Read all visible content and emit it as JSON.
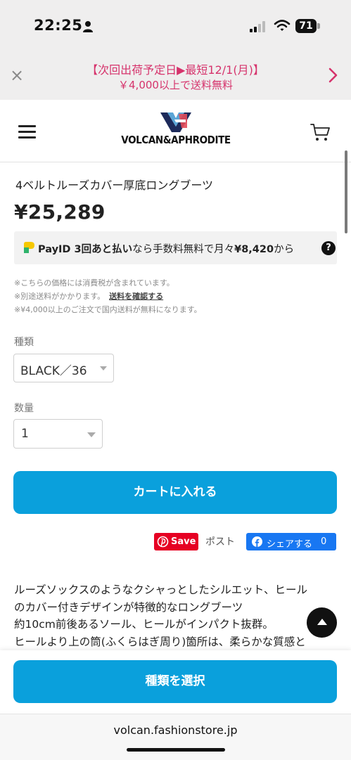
{
  "status_bar": {
    "time": "22:25",
    "battery": "71",
    "icons": [
      "person-icon",
      "signal-icon",
      "wifi-icon",
      "battery-icon"
    ]
  },
  "announcement": {
    "line1": "【次回出荷予定日▶最短12/1(月)】",
    "line2": "￥4,000以上で送料無料",
    "color": "#d6336c"
  },
  "header": {
    "logo_text": "VOLCAN&APHRODITE",
    "icons": [
      "hamburger-menu-icon",
      "cart-icon"
    ]
  },
  "product": {
    "title": "4ベルトルーズカバー厚底ロングブーツ",
    "price": "¥25,289"
  },
  "payid": {
    "brand": "PayID 3回あと払い",
    "middle": "なら手数料無料で月々",
    "amount": "¥8,420",
    "suffix": "から",
    "help": "?"
  },
  "notes": {
    "line1": "※こちらの価格には消費税が含まれています。",
    "line2_prefix": "※別途送料がかかります。",
    "line2_link": "送料を確認する",
    "line3": "※¥4,000以上のご注文で国内送料が無料になります。"
  },
  "variant": {
    "label": "種類",
    "value": "BLACK／36"
  },
  "quantity": {
    "label": "数量",
    "value": "1"
  },
  "add_to_cart": {
    "label": "カートに入れる",
    "color": "#0aa0dc"
  },
  "share": {
    "pinterest_label": "Save",
    "post_label": "ポスト",
    "facebook_label": "シェアする",
    "facebook_count": "0"
  },
  "description": [
    "ルーズソックスのようなクシャっとしたシルエット、ヒール",
    "のカバー付きデザインが特徴的なロングブーツ",
    "約10cm前後あるソール、ヒールがインパクト抜群。",
    "ヒールより上の筒(ふくらはぎ周り)箇所は、柔らかな質感と"
  ],
  "sticky": {
    "select_label": "種類を選択"
  },
  "browser": {
    "url": "volcan.fashionstore.jp"
  }
}
